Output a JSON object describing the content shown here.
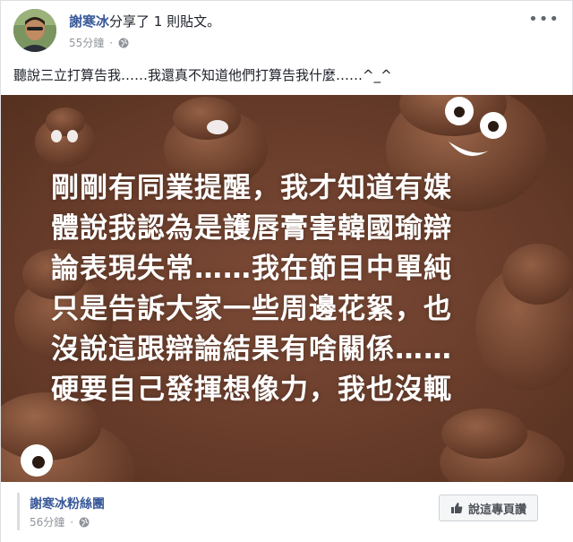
{
  "post": {
    "author": "謝寒冰",
    "action": "分享了 1 則貼文。",
    "time": "55分鐘",
    "privacy_icon": "globe-icon",
    "text": "聽說三立打算告我……我還真不知道他們打算告我什麼……^_^"
  },
  "image": {
    "lines": [
      "剛剛有同業提醒，我才知道有媒",
      "體說我認為是護唇膏害韓國瑜辯",
      "論表現失常……我在節目中單純",
      "只是告訴大家一些周邊花絮，也",
      "沒說這跟辯論結果有啥關係……",
      "硬要自己發揮想像力，我也沒輒"
    ]
  },
  "shared": {
    "page_name": "謝寒冰粉絲團",
    "time": "56分鐘",
    "like_button": "說這專頁讚"
  },
  "colors": {
    "link_blue": "#385898",
    "image_bg": "#6a3d2b"
  }
}
